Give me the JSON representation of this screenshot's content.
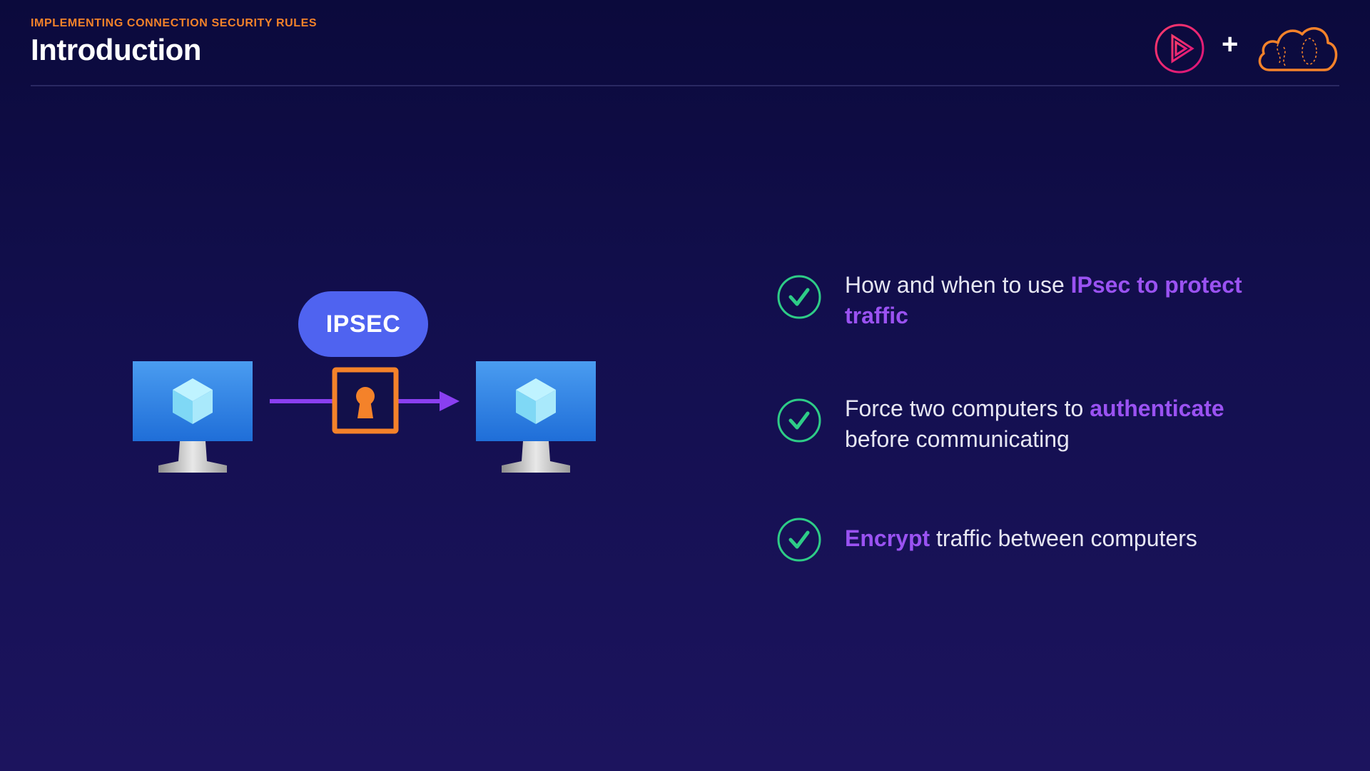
{
  "header": {
    "section_label": "IMPLEMENTING CONNECTION SECURITY RULES",
    "title": "Introduction"
  },
  "brand": {
    "plus_symbol": "+",
    "icons": [
      "pluralsight-play-icon",
      "cloud-logo-icon"
    ],
    "colors": {
      "pluralsight": "#e81f63",
      "cloud": "#f4822a"
    }
  },
  "diagram": {
    "badge_label": "IPSEC",
    "icons": [
      "computer-monitor-icon",
      "lock-keyhole-icon",
      "arrow-right-icon"
    ],
    "colors": {
      "badge": "#4f63f0",
      "arrow": "#8a3ff0",
      "lock": "#f4822a",
      "monitor": "#2f7de0"
    }
  },
  "checklist": {
    "items": [
      {
        "before": "How and when to use ",
        "highlight": "IPsec to protect traffic",
        "after": ""
      },
      {
        "before": "Force two computers to ",
        "highlight": "authenticate",
        "after": " before communicating"
      },
      {
        "before": "",
        "highlight": "Encrypt",
        "after": " traffic between computers"
      }
    ],
    "colors": {
      "check": "#2ecc87",
      "highlight": "#9a52f2"
    }
  }
}
